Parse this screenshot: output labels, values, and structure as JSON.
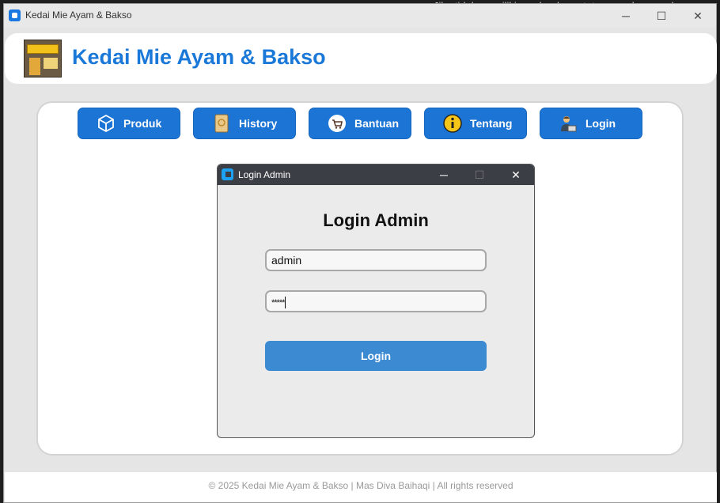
{
  "window": {
    "title": "Kedai Mie Ayam & Bakso",
    "controls": {
      "minimize": "─",
      "maximize": "☐",
      "close": "✕"
    }
  },
  "header": {
    "title": "Kedai Mie Ayam & Bakso",
    "logo": "shop-front-logo"
  },
  "nav": [
    {
      "label": "Produk",
      "icon": "box-icon"
    },
    {
      "label": "History",
      "icon": "scroll-icon"
    },
    {
      "label": "Bantuan",
      "icon": "cart-icon"
    },
    {
      "label": "Tentang",
      "icon": "info-icon"
    },
    {
      "label": "Login",
      "icon": "user-laptop-icon"
    }
  ],
  "dialog": {
    "title": "Login Admin",
    "heading": "Login Admin",
    "username_value": "admin",
    "password_mask": "*****",
    "login_label": "Login",
    "controls": {
      "minimize": "─",
      "maximize": "☐",
      "close": "✕"
    }
  },
  "footer": {
    "text": "© 2025 Kedai Mie Ayam & Bakso | Mas Diva Baihaqi | All rights reserved"
  },
  "background": {
    "editor_text": "Jika tidak memiliki gambar baru, tetap gunakan gambar"
  },
  "colors": {
    "accent": "#1c74d4",
    "login_button": "#3b8ad2",
    "dialog_bar": "#3b3f45"
  }
}
